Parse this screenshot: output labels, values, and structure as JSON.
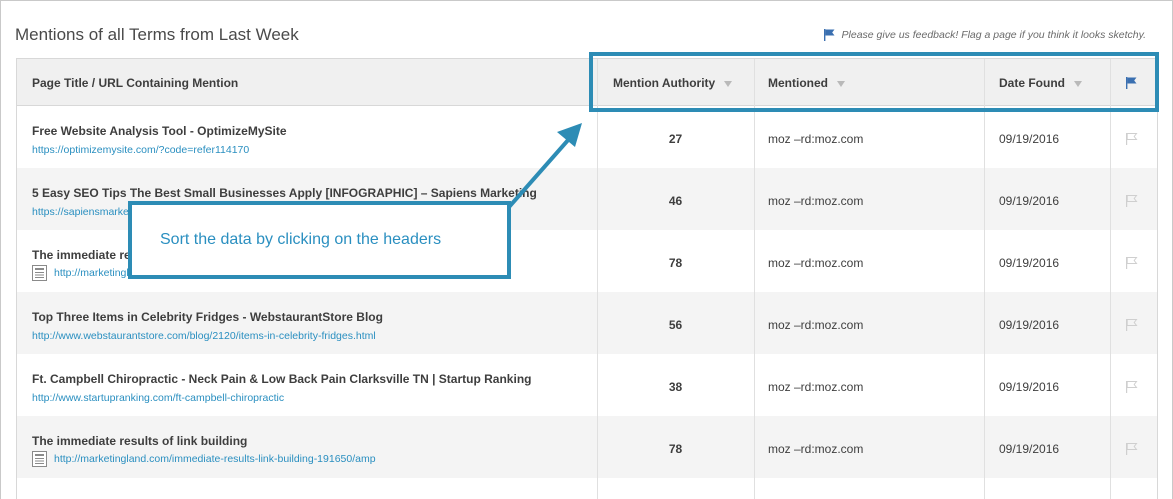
{
  "page": {
    "title": "Mentions of all Terms from Last Week",
    "feedback_text": "Please give us feedback! Flag a page if you think it looks sketchy."
  },
  "table": {
    "columns": {
      "page": "Page Title / URL Containing Mention",
      "authority": "Mention Authority",
      "mentioned": "Mentioned",
      "date": "Date Found"
    },
    "rows": [
      {
        "title": "Free Website Analysis Tool - OptimizeMySite",
        "url": "https://optimizemysite.com/?code=refer114170",
        "authority": "27",
        "mentioned": "moz –rd:moz.com",
        "date": "09/19/2016",
        "doc_icon": false
      },
      {
        "title": "5 Easy SEO Tips The Best Small Businesses Apply [INFOGRAPHIC] – Sapiens Marketing",
        "url": "https://sapiensmarketing.com/5-easy-seo-tips-the-best-small-businesses-apply-infog…",
        "authority": "46",
        "mentioned": "moz –rd:moz.com",
        "date": "09/19/2016",
        "doc_icon": false
      },
      {
        "title": "The immediate results of link building",
        "url": "http://marketingland.com/immediate-results-link-building-191650?utm_source=dlvr.it",
        "authority": "78",
        "mentioned": "moz –rd:moz.com",
        "date": "09/19/2016",
        "doc_icon": true
      },
      {
        "title": "Top Three Items in Celebrity Fridges - WebstaurantStore Blog",
        "url": "http://www.webstaurantstore.com/blog/2120/items-in-celebrity-fridges.html",
        "authority": "56",
        "mentioned": "moz –rd:moz.com",
        "date": "09/19/2016",
        "doc_icon": false
      },
      {
        "title": "Ft. Campbell Chiropractic - Neck Pain & Low Back Pain Clarksville TN | Startup Ranking",
        "url": "http://www.startupranking.com/ft-campbell-chiropractic",
        "authority": "38",
        "mentioned": "moz –rd:moz.com",
        "date": "09/19/2016",
        "doc_icon": false
      },
      {
        "title": "The immediate results of link building",
        "url": "http://marketingland.com/immediate-results-link-building-191650/amp",
        "authority": "78",
        "mentioned": "moz –rd:moz.com",
        "date": "09/19/2016",
        "doc_icon": true
      }
    ]
  },
  "callout": {
    "text": "Sort the data by clicking on the headers"
  },
  "colors": {
    "accent": "#2d8cb5",
    "link": "#2a8fc0",
    "header_bg": "#f0f0f0",
    "flag_active": "#3a6fb0",
    "flag_inactive": "#cfcfcf"
  },
  "icons": {
    "feedback": "flag-icon",
    "header_flag": "flag-icon",
    "row_flag": "flag-outline-icon",
    "document": "document-icon",
    "sort": "sort-caret-icon"
  }
}
